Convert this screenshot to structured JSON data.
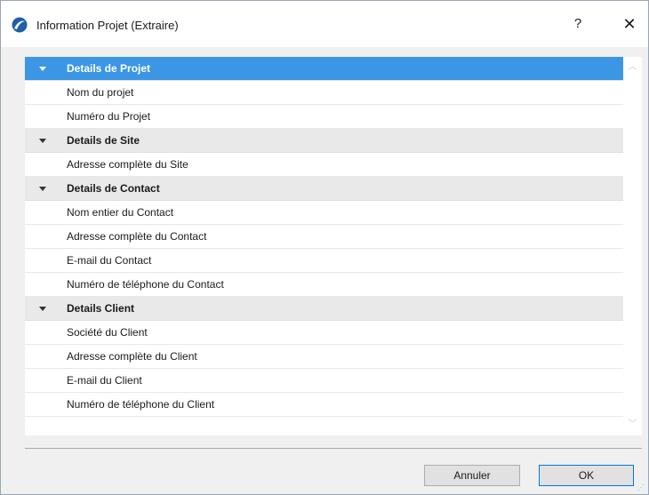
{
  "window": {
    "title": "Information Projet (Extraire)",
    "help_label": "?",
    "close_label": "✕"
  },
  "list": {
    "groups": [
      {
        "label": "Details de Projet",
        "selected": true,
        "items": [
          "Nom du projet",
          "Numéro du Projet"
        ]
      },
      {
        "label": "Details de Site",
        "selected": false,
        "items": [
          "Adresse complète du Site"
        ]
      },
      {
        "label": "Details de Contact",
        "selected": false,
        "items": [
          "Nom entier du Contact",
          "Adresse complète du Contact",
          "E-mail du Contact",
          "Numéro de téléphone du Contact"
        ]
      },
      {
        "label": "Details Client",
        "selected": false,
        "items": [
          "Société du Client",
          "Adresse complète du Client",
          "E-mail du Client",
          "Numéro de téléphone du Client"
        ]
      }
    ]
  },
  "scrollbar": {
    "up_label": "︿",
    "down_label": "﹀"
  },
  "buttons": {
    "cancel_label": "Annuler",
    "ok_label": "OK"
  },
  "colors": {
    "selection": "#3c96e6",
    "group_bg": "#e9e9e9",
    "accent": "#0078d7"
  },
  "icons": {
    "app": "archicad-logo-icon",
    "expand": "triangle-down-icon",
    "close": "close-icon",
    "help": "help-icon"
  }
}
